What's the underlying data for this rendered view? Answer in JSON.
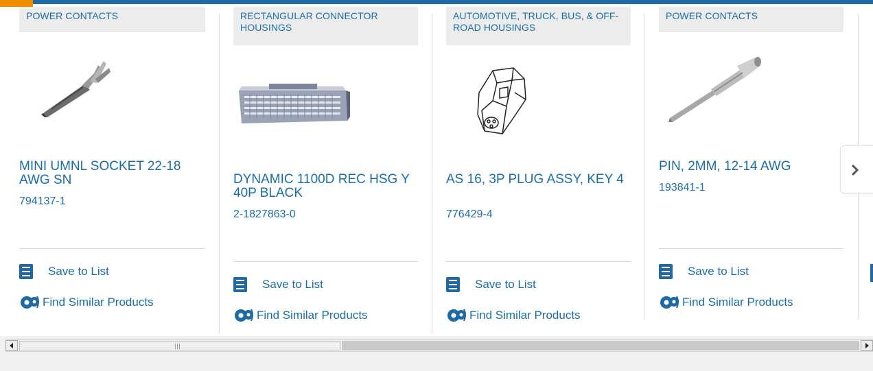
{
  "products": [
    {
      "category": "POWER CONTACTS",
      "title": "MINI UMNL SOCKET 22-18 AWG SN",
      "part_number": "794137-1",
      "save_label": "Save to List",
      "similar_label": "Find Similar Products"
    },
    {
      "category": "RECTANGULAR CONNECTOR HOUSINGS",
      "title": "DYNAMIC 1100D REC HSG Y 40P BLACK",
      "part_number": "2-1827863-0",
      "save_label": "Save to List",
      "similar_label": "Find Similar Products"
    },
    {
      "category": "AUTOMOTIVE, TRUCK, BUS, & OFF-ROAD HOUSINGS",
      "title": "AS 16, 3P PLUG ASSY, KEY 4",
      "part_number": "776429-4",
      "save_label": "Save to List",
      "similar_label": "Find Similar Products"
    },
    {
      "category": "POWER CONTACTS",
      "title": "PIN, 2MM, 12-14 AWG",
      "part_number": "193841-1",
      "save_label": "Save to List",
      "similar_label": "Find Similar Products"
    }
  ],
  "colors": {
    "accent_blue": "#1a6ea8",
    "top_bar_blue": "#1e6aa5",
    "top_bar_orange": "#f28d00",
    "category_bg": "#ececec"
  },
  "icons": {
    "save": "checklist-icon",
    "similar": "gears-icon",
    "next": "chevron-right-icon"
  }
}
